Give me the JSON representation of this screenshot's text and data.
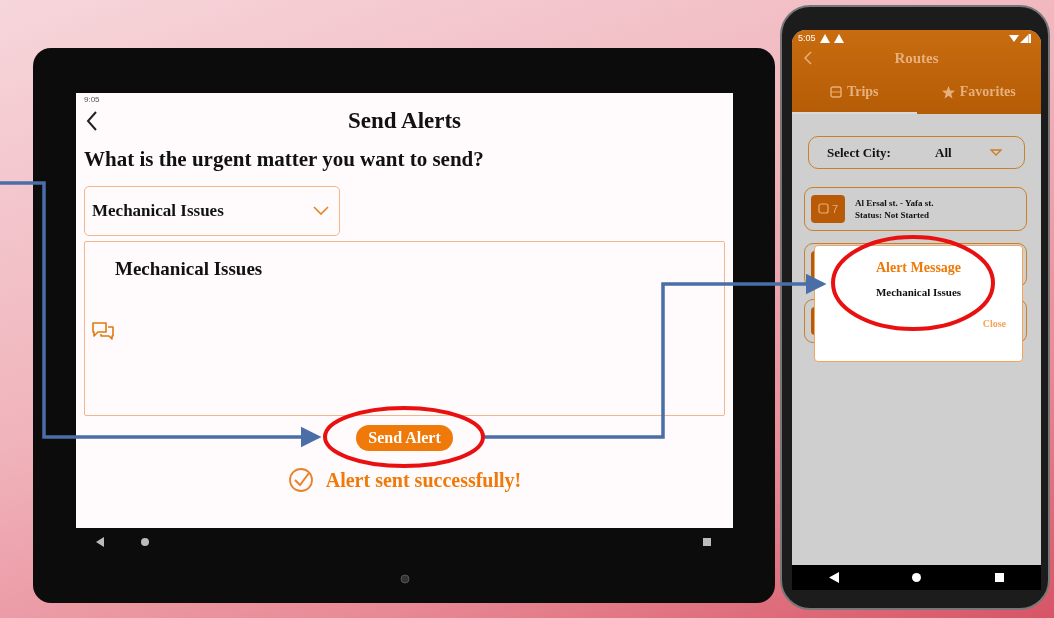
{
  "tablet": {
    "status_time": "9:05",
    "title": "Send Alerts",
    "question": "What is the urgent matter you want to send?",
    "dropdown": {
      "value": "Mechanical Issues"
    },
    "message": {
      "value": "Mechanical Issues"
    },
    "send_button": "Send Alert",
    "success": "Alert sent successfully!"
  },
  "phone": {
    "status_time": "5:05",
    "title": "Routes",
    "tabs": [
      {
        "label": "Trips",
        "selected": true
      },
      {
        "label": "Favorites",
        "selected": false
      }
    ],
    "city": {
      "label": "Select City:",
      "value": "All"
    },
    "routes": [
      {
        "number": "7",
        "name": "Al Ersal st. - Yafa st.",
        "status": "Status: Not Started"
      }
    ],
    "dialog": {
      "title": "Alert Message",
      "message": "Mechanical Issues",
      "close": "Close"
    }
  }
}
